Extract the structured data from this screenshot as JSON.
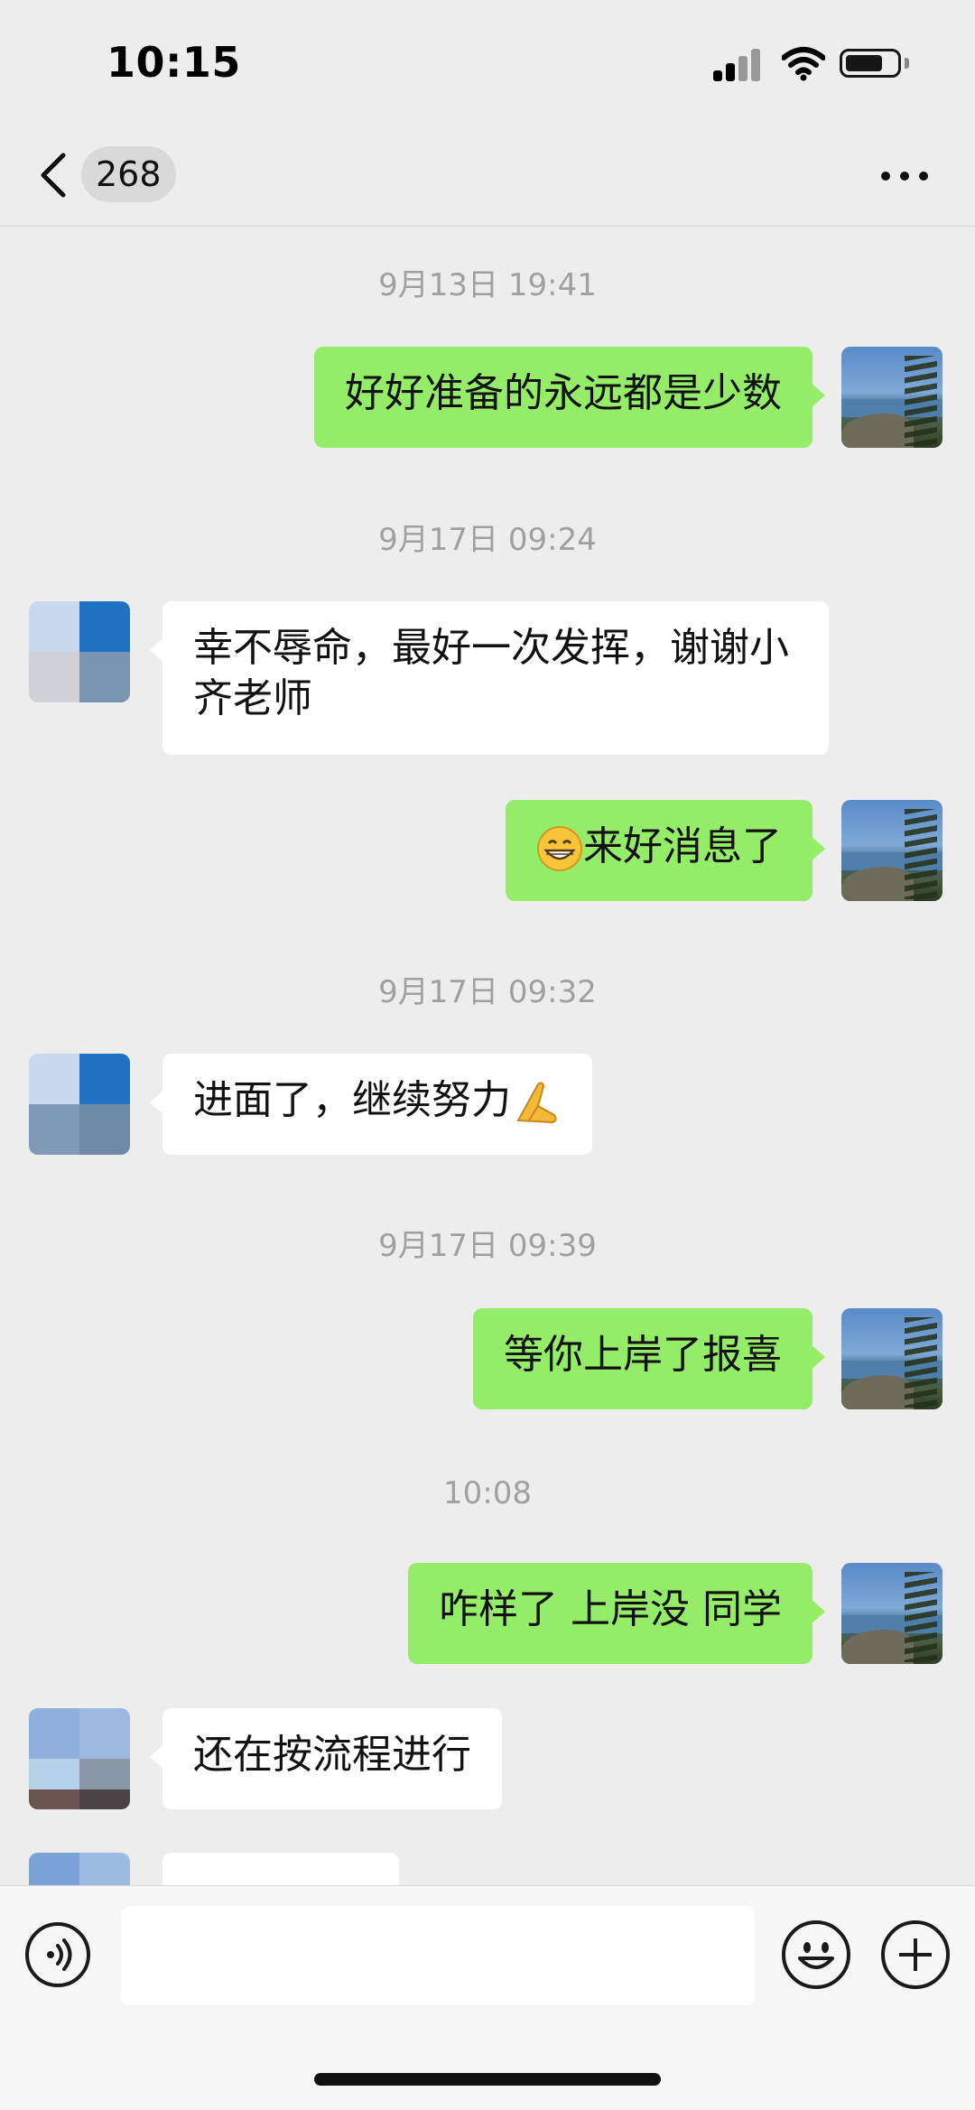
{
  "status_bar": {
    "time": "10:15"
  },
  "nav": {
    "unread_count": "268"
  },
  "messages": [
    {
      "type": "timestamp",
      "text": "9月13日 19:41"
    },
    {
      "type": "self",
      "text": "好好准备的永远都是少数"
    },
    {
      "type": "timestamp",
      "text": "9月17日 09:24"
    },
    {
      "type": "peer",
      "text": "幸不辱命，最好一次发挥，谢谢小齐老师"
    },
    {
      "type": "self",
      "text": "来好消息了",
      "emoji": "grinning-face-emoji"
    },
    {
      "type": "timestamp",
      "text": "9月17日 09:32"
    },
    {
      "type": "peer",
      "text": "进面了，继续努力",
      "emoji": "praying-hands-emoji"
    },
    {
      "type": "timestamp",
      "text": "9月17日 09:39"
    },
    {
      "type": "self",
      "text": "等你上岸了报喜"
    },
    {
      "type": "timestamp",
      "text": "10:08"
    },
    {
      "type": "self",
      "text": "咋样了 上岸没 同学"
    },
    {
      "type": "peer",
      "text": "还在按流程进行"
    }
  ],
  "input": {
    "value": ""
  },
  "icons": {
    "back": "chevron-left-icon",
    "more": "ellipsis-icon",
    "voice": "voice-icon",
    "emoji": "smiley-icon",
    "plus": "plus-icon"
  },
  "colors": {
    "self_bubble": "#95ec69",
    "peer_bubble": "#ffffff",
    "background": "#ededed"
  }
}
